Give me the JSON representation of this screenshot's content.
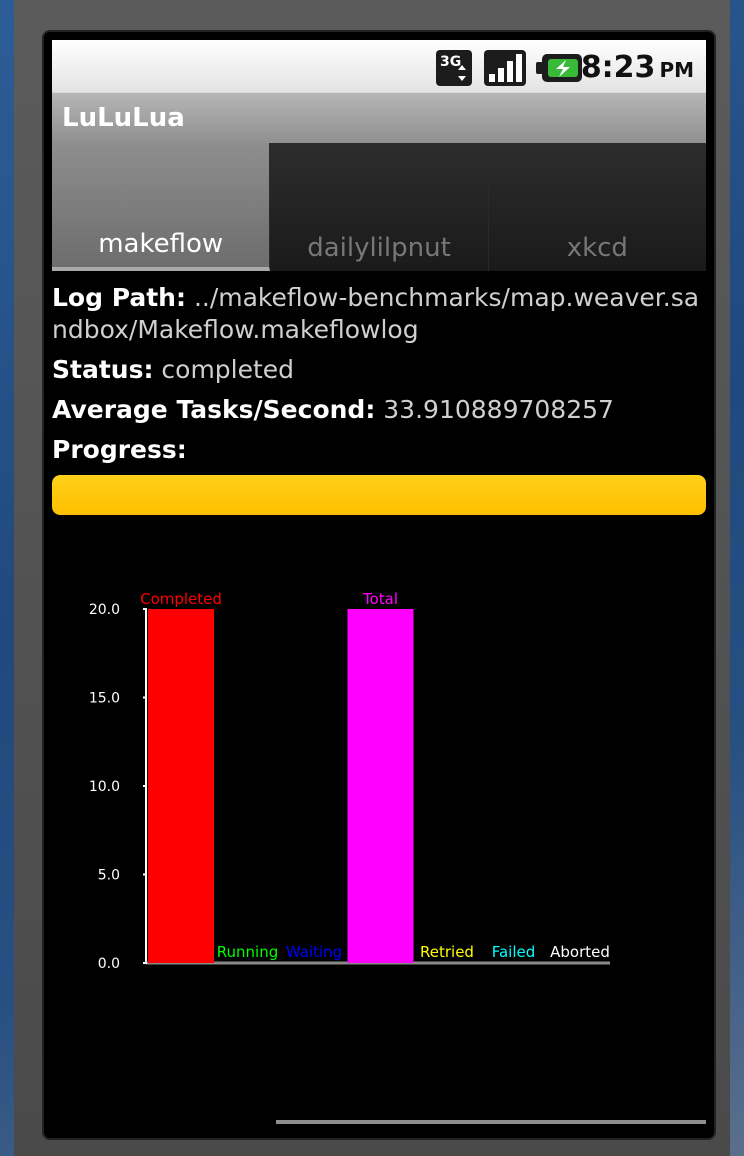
{
  "status_bar": {
    "network_icon": "3g-signal-icon",
    "signal_icon": "signal-strength-icon",
    "battery_icon": "battery-charging-icon",
    "time": "8:23",
    "ampm": "PM"
  },
  "app": {
    "title": "LuLuLua"
  },
  "tabs": [
    {
      "label": "makeflow",
      "selected": true
    },
    {
      "label": "dailylilpnut",
      "selected": false
    },
    {
      "label": "xkcd",
      "selected": false
    }
  ],
  "info": {
    "log_path_label": "Log Path:",
    "log_path_value": "../makeflow-benchmarks/map.weaver.sandbox/Makeflow.makeflowlog",
    "status_label": "Status:",
    "status_value": "completed",
    "avg_label": "Average Tasks/Second:",
    "avg_value": "33.910889708257",
    "progress_label": "Progress:"
  },
  "progress": {
    "value": 1.0,
    "color": "#ffbf00"
  },
  "chart_data": {
    "type": "bar",
    "categories": [
      "Completed",
      "Running",
      "Waiting",
      "Total",
      "Retried",
      "Failed",
      "Aborted"
    ],
    "values": [
      20,
      0,
      0,
      20,
      0,
      0,
      0
    ],
    "colors": [
      "#ff0000",
      "#00ff00",
      "#0000ff",
      "#ff00ff",
      "#ffff00",
      "#00ffff",
      "#ffffff"
    ],
    "yticks": [
      "0.0",
      "5.0",
      "10.0",
      "15.0",
      "20.0"
    ],
    "ylim": [
      0,
      20
    ],
    "title": "",
    "xlabel": "",
    "ylabel": "",
    "grid": false,
    "legend": "none"
  }
}
